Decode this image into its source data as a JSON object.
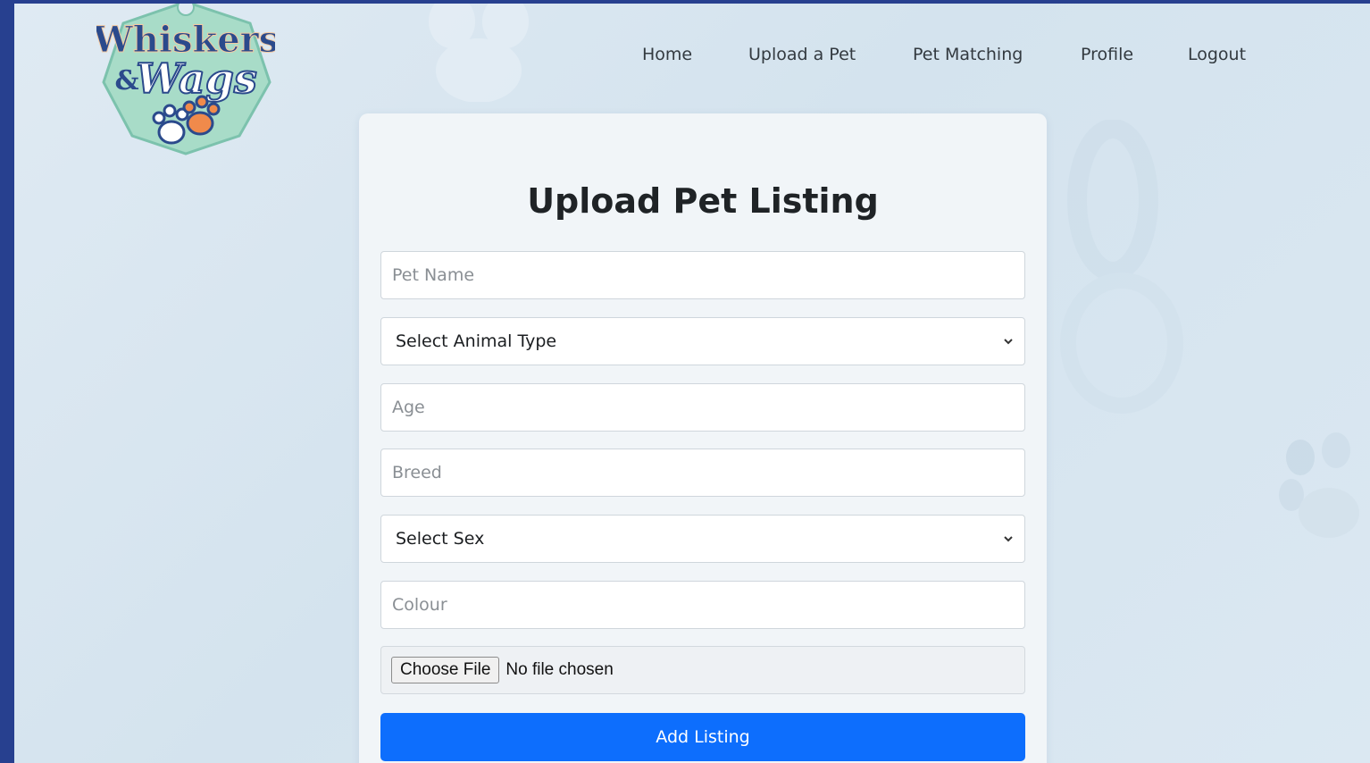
{
  "brand": {
    "line1": "Whiskers",
    "line2": "Wags",
    "ampersand": "&"
  },
  "nav": {
    "home": "Home",
    "upload": "Upload a Pet",
    "matching": "Pet Matching",
    "profile": "Profile",
    "logout": "Logout"
  },
  "form": {
    "title": "Upload Pet Listing",
    "pet_name_placeholder": "Pet Name",
    "animal_type_selected": "Select Animal Type",
    "age_placeholder": "Age",
    "breed_placeholder": "Breed",
    "sex_selected": "Select Sex",
    "colour_placeholder": "Colour",
    "file_button": "Choose File",
    "file_status": "No file chosen",
    "submit_label": "Add Listing"
  },
  "icons": {
    "logo_badge": "paw-badge-logo",
    "select_arrow": "chevron-down-icon",
    "background": "paw-print-icon"
  },
  "colors": {
    "primary_button": "#0d6efd",
    "page_background": "#dfeaf3",
    "frame": "#27408f",
    "logo_navy": "#2b4a8c",
    "logo_mint": "#a8dcc8",
    "logo_orange": "#f08a4b"
  }
}
